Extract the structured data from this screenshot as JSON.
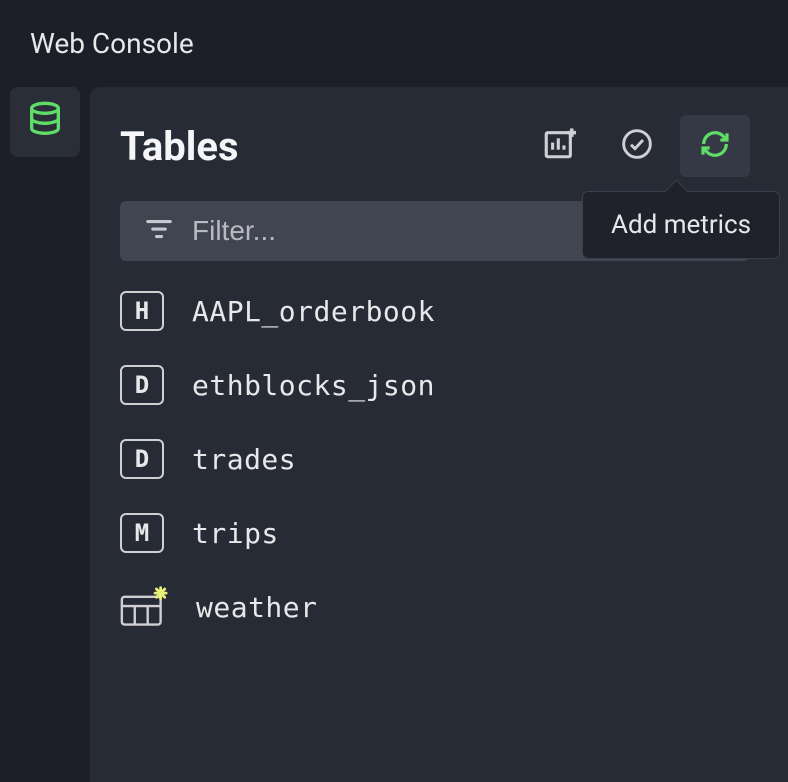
{
  "titlebar": {
    "title": "Web Console"
  },
  "panel": {
    "title": "Tables",
    "filter_placeholder": "Filter...",
    "tooltip_add_metrics": "Add metrics"
  },
  "icons": {
    "database": "database-icon",
    "add_metrics": "chart-plus-icon",
    "check": "check-circle-icon",
    "refresh": "refresh-icon",
    "filter": "filter-lines-icon"
  },
  "colors": {
    "accent_green": "#5fdd66",
    "background": "#1c1f27",
    "panel": "#272b35",
    "star": "#e8f07a"
  },
  "tables": [
    {
      "type_label": "H",
      "name": "AAPL_orderbook",
      "kind": "letter"
    },
    {
      "type_label": "D",
      "name": "ethblocks_json",
      "kind": "letter"
    },
    {
      "type_label": "D",
      "name": "trades",
      "kind": "letter"
    },
    {
      "type_label": "M",
      "name": "trips",
      "kind": "letter"
    },
    {
      "type_label": "",
      "name": "weather",
      "kind": "materialized"
    }
  ]
}
